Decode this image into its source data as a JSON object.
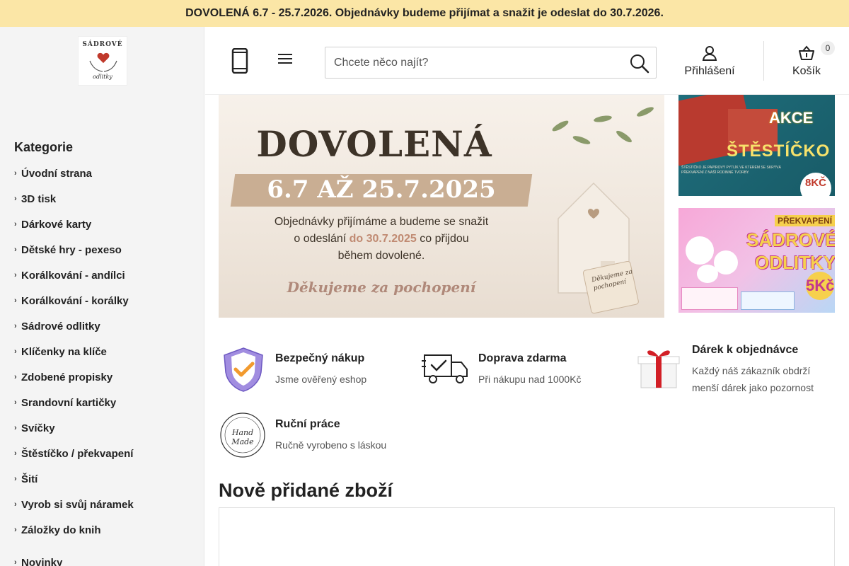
{
  "announcement": "DOVOLENÁ 6.7 - 25.7.2026. Objednávky budeme přijímat a snažit je odeslat do 30.7.2026.",
  "logo": {
    "line1": "SÁDROVÉ",
    "line2": "odlitky"
  },
  "sidebar": {
    "title": "Kategorie",
    "items": [
      "Úvodní strana",
      "3D tisk",
      "Dárkové karty",
      "Dětské hry - pexeso",
      "Korálkování - andílci",
      "Korálkování - korálky",
      "Sádrové odlitky",
      "Klíčenky na klíče",
      "Zdobené propisky",
      "Srandovní kartičky",
      "Svíčky",
      "Štěstíčko / překvapení",
      "Šití",
      "Vyrob si svůj náramek",
      "Záložky do knih",
      "Novinky"
    ]
  },
  "header": {
    "search_placeholder": "Chcete něco najít?",
    "login_label": "Přihlášení",
    "cart_label": "Košík",
    "cart_count": "0"
  },
  "hero": {
    "title": "DOVOLENÁ",
    "dates": "6.7 AŽ 25.7.2025",
    "text_line1": "Objednávky přijímáme a budeme se snažit",
    "text_line2a": "o odeslání ",
    "text_line2b": "do 30.7.2025",
    "text_line2c": " co přijdou",
    "text_line3": "během dovolené.",
    "thanks": "Děkujeme za pochopení",
    "tag": "Děkujeme za pochopení"
  },
  "banner1": {
    "title": "AKCE",
    "subtitle": "ŠTĚSTÍČKO",
    "small": "ŠTĚSTÍČKO JE PAPÍROVÝ PYTLÍK VE KTERÉM SE SKRÝVÁ PŘEKVAPENÍ Z NAŠÍ RODINNÉ TVORBY.",
    "price": "8KČ"
  },
  "banner2": {
    "label": "PŘEKVAPENÍ",
    "title1": "SÁDROVÉ",
    "title2": "ODLITKY",
    "price": "5Kč"
  },
  "features": [
    {
      "title": "Bezpečný nákup",
      "desc": "Jsme ověřený eshop",
      "icon": "shield-check-icon"
    },
    {
      "title": "Doprava zdarma",
      "desc": "Při nákupu nad 1000Kč",
      "icon": "delivery-truck-icon"
    },
    {
      "title": "Dárek k objednávce",
      "desc1": "Každý náš zákazník obdrží",
      "desc2": "menší dárek jako pozornost",
      "icon": "gift-box-icon"
    },
    {
      "title": "Ruční práce",
      "desc": "Ručně vyrobeno s láskou",
      "icon": "handmade-stamp-icon",
      "stamp_text": "Hand Made"
    }
  ],
  "section": {
    "title": "Nově přidané zboží"
  },
  "colors": {
    "announcement_bg": "#fbe6a6",
    "sidebar_bg": "#f4f4f4",
    "accent_heart": "#c0392b"
  }
}
